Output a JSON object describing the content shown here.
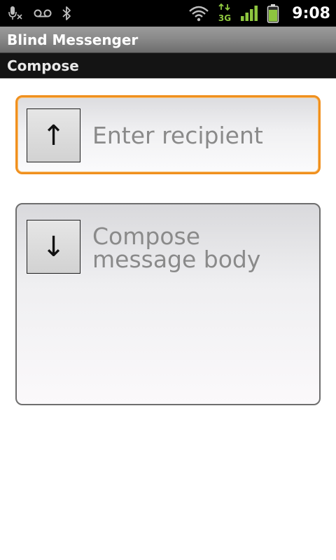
{
  "status_bar": {
    "time": "9:08",
    "icons": [
      "mic-muted-icon",
      "voicemail-icon",
      "bluetooth-icon",
      "wifi-icon",
      "3g-data-icon",
      "signal-icon",
      "battery-icon"
    ],
    "network_label": "3G",
    "accent_color": "#8ec63f"
  },
  "app": {
    "title": "Blind Messenger"
  },
  "section": {
    "title": "Compose"
  },
  "recipient": {
    "arrow": "↑",
    "placeholder": "Enter recipient",
    "focus_color": "#f0901e"
  },
  "message_body": {
    "arrow": "↓",
    "placeholder": "Compose message body"
  }
}
